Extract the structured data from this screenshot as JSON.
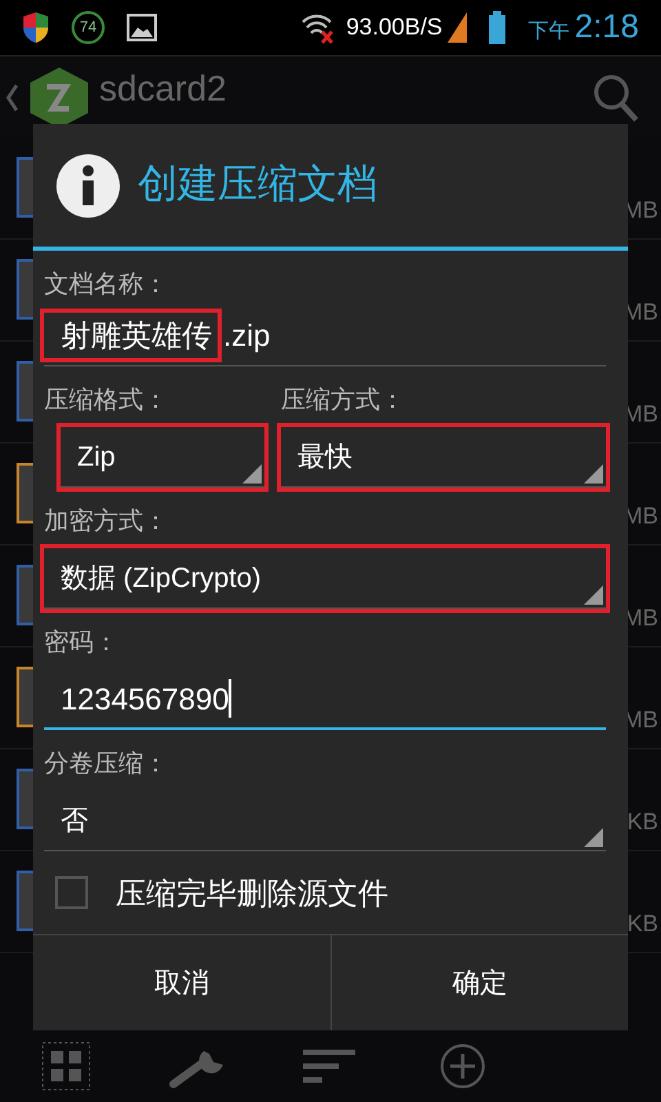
{
  "status_bar": {
    "battery_badge": "74",
    "speed": "93.00B/S",
    "ampm": "下午",
    "time": "2:18"
  },
  "app_bar": {
    "title": "sdcard2"
  },
  "file_list": [
    {
      "size": "MB",
      "color": "#2f5fa8"
    },
    {
      "size": "MB",
      "color": "#2f5fa8"
    },
    {
      "size": "MB",
      "color": "#2f5fa8"
    },
    {
      "size": "MB",
      "color": "#c7842a"
    },
    {
      "size": "MB",
      "color": "#2f5fa8"
    },
    {
      "size": "MB",
      "color": "#c7842a"
    },
    {
      "size": "KB",
      "color": "#2f5fa8"
    },
    {
      "size": "KB",
      "color": "#2f5fa8"
    }
  ],
  "toolbar": [
    {
      "kind": "grid",
      "selected": true
    },
    {
      "kind": "wrench",
      "selected": false
    },
    {
      "kind": "sort",
      "selected": false
    },
    {
      "kind": "add",
      "selected": false
    }
  ],
  "dialog": {
    "title": "创建压缩文档",
    "name_label": "文档名称：",
    "name_base": "射雕英雄传",
    "name_extension": ".zip",
    "name_highlighted": true,
    "format_label": "压缩格式：",
    "format_value": "Zip",
    "format_highlighted": true,
    "method_label": "压缩方式：",
    "method_value": "最快",
    "method_highlighted": true,
    "encryption_label": "加密方式：",
    "encryption_value": "数据 (ZipCrypto)",
    "encryption_highlighted": true,
    "password_label": "密码：",
    "password_value": "1234567890",
    "password_focused": true,
    "split_label": "分卷压缩：",
    "split_value": "否",
    "delete_source": {
      "label": "压缩完毕删除源文件",
      "checked": false
    },
    "buttons": [
      "取消",
      "确定"
    ]
  }
}
